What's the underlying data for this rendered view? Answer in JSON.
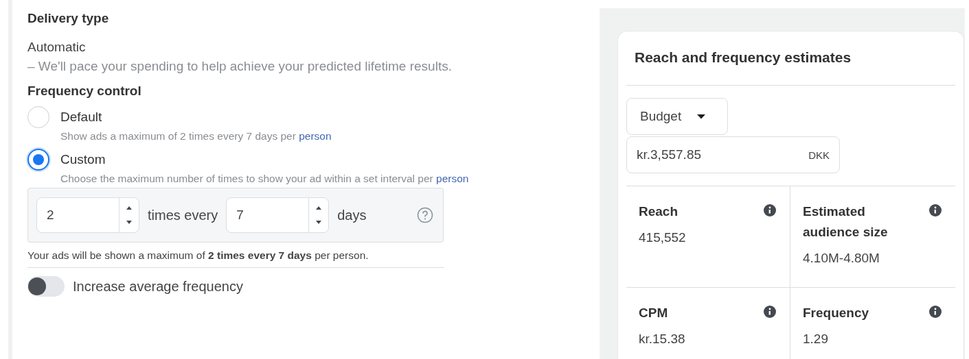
{
  "delivery_type": {
    "title": "Delivery type",
    "value": "Automatic",
    "description": "– We'll pace your spending to help achieve your predicted lifetime results."
  },
  "frequency_control": {
    "title": "Frequency control",
    "options": [
      {
        "label": "Default",
        "selected": false,
        "description": "Show ads a maximum of 2 times every 7 days per",
        "link": "person"
      },
      {
        "label": "Custom",
        "selected": true,
        "description": "Choose the maximum number of times to show your ad within a set interval per",
        "link": "person"
      }
    ]
  },
  "custom_interval": {
    "times_value": "2",
    "times_label": "times every",
    "days_value": "7",
    "days_label": "days"
  },
  "summary": "Your ads will be shown a maximum of **2 times every 7 days** per person.",
  "increase_frequency": {
    "label": "Increase average frequency",
    "on": false
  },
  "estimates": {
    "title": "Reach and frequency estimates",
    "metric_dropdown": "Budget",
    "budget_value": "kr.3,557.85",
    "currency": "DKK",
    "metrics": [
      {
        "label": "Reach",
        "value": "415,552"
      },
      {
        "label": "Estimated audience size",
        "value": "4.10M-4.80M"
      },
      {
        "label": "CPM",
        "value": "kr.15.38"
      },
      {
        "label": "Frequency",
        "value": "1.29"
      }
    ]
  }
}
